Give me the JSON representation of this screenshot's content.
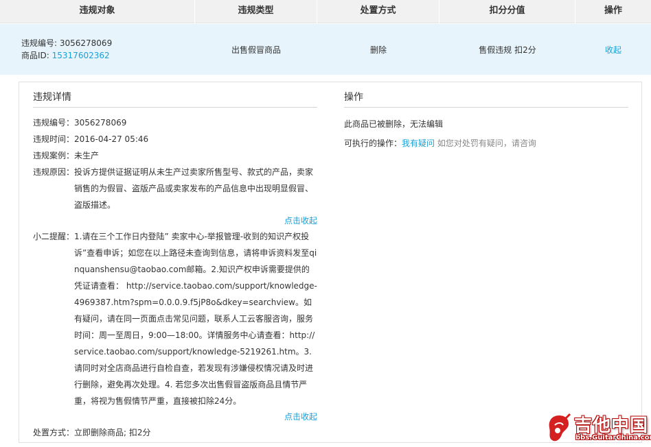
{
  "table": {
    "headers": [
      "违规对象",
      "违规类型",
      "处置方式",
      "扣分分值",
      "操作"
    ],
    "row": {
      "violation_no": "违规编号: 3056278069",
      "item_id_label": "商品ID: ",
      "item_id": "15317602362",
      "type": "出售假冒商品",
      "disposal": "删除",
      "points": "售假违规 扣2分",
      "action": "收起"
    }
  },
  "detail": {
    "title": "违规详情",
    "no_label": "违规编号：",
    "no_value": "3056278069",
    "time_label": "违规时间：",
    "time_value": "2016-04-27 05:46",
    "case_label": "违规案例：",
    "case_value": "未生产",
    "reason_label": "违规原因：",
    "reason_value": "投诉方提供证据证明从未生产过卖家所售型号、款式的产品，卖家销售的为假冒、盗版产品或卖家发布的产品信息中出现明显假冒、盗版描述。",
    "collapse_1": "点击收起",
    "tip_label": "小二提醒：",
    "tip_value": "1.请在三个工作日内登陆” 卖家中心-举报管理-收到的知识产权投诉”查看申诉；如您在以上路径未查询到信息，请将申诉资料发至qinquanshensu@taobao.com邮箱。2.知识产权申诉需要提供的凭证请查看： http://service.taobao.com/support/knowledge-4969387.htm?spm=0.0.0.9.f5jP8o&dkey=searchview。如有疑问，请在同一页面点击常见问题，联系人工云客服咨询，服务时间：周一至周日，9:00—18:00。详情服务中心请查看：http://service.taobao.com/support/knowledge-5219261.htm。3.请同时对全店商品进行自检自查，若发现有涉嫌侵权情况请及时进行删除，避免再次处理。4. 若您多次出售假冒盗版商品且情节严重，将视为售假情节严重，直接被扣除24分。",
    "collapse_2": "点击收起",
    "disposal_label": "处置方式：",
    "disposal_value": "立即删除商品; 扣2分"
  },
  "operation": {
    "title": "操作",
    "status": "此商品已被删除，无法编辑",
    "actions_label": "可执行的操作：",
    "actions_link": "我有疑问",
    "actions_hint": "如您对处罚有疑问，请咨询"
  },
  "watermark": {
    "cn": "吉他中国",
    "url": "bbs.GuitarChina.com"
  },
  "colors": {
    "link": "#1aa0d8",
    "row_bg": "#e8f4fb",
    "header_bg": "#f1f1f1"
  }
}
